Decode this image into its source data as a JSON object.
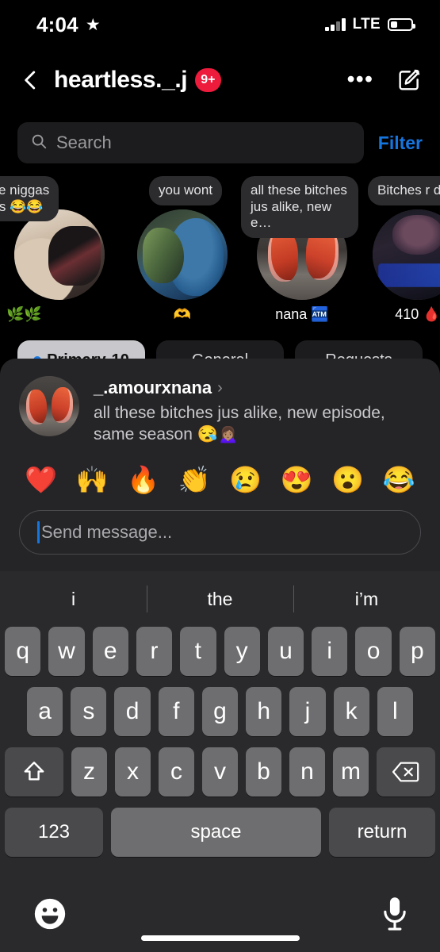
{
  "status_bar": {
    "time": "4:04",
    "star_icon": "star-icon",
    "signal_icon": "cellular-signal-icon",
    "network": "LTE",
    "battery_icon": "battery-icon",
    "battery_level": "35"
  },
  "header": {
    "back_icon": "back-chevron-icon",
    "title": "heartless._.j",
    "badge": "9+",
    "more_icon": "more-options-icon",
    "compose_icon": "compose-new-message-icon"
  },
  "search": {
    "icon": "search-icon",
    "placeholder": "Search",
    "filter_label": "Filter"
  },
  "notes": [
    {
      "bubble": "ese niggas\nhes 😂😂",
      "username": "🌿🌿",
      "avatar": "note-avatar-photo"
    },
    {
      "bubble": "you wont",
      "username": "🫶",
      "avatar": "note-avatar-photo"
    },
    {
      "bubble": "all these bitches\njus alike, new e…",
      "username": "nana 🏧",
      "avatar": "note-avatar-photo"
    },
    {
      "bubble": "Bitches r dicks",
      "username": "410 🩸",
      "avatar": "note-avatar-photo"
    }
  ],
  "inbox_tabs": [
    {
      "label": "Primary",
      "count": "10",
      "active": true
    },
    {
      "label": "General",
      "count": "",
      "active": false
    },
    {
      "label": "Requests",
      "count": "",
      "active": false
    }
  ],
  "reply_sheet": {
    "avatar": "sheet-avatar-photo",
    "username": "_.amourxnana",
    "chevron_icon": "chevron-right-icon",
    "note_text": "all these bitches jus alike, new episode, same season 😪🙍🏽‍♀️",
    "reactions": [
      "❤️",
      "🙌",
      "🔥",
      "👏",
      "😢",
      "😍",
      "😮",
      "😂"
    ],
    "composer_placeholder": "Send message..."
  },
  "keyboard": {
    "predictions": [
      "i",
      "the",
      "i’m"
    ],
    "row1": [
      "q",
      "w",
      "e",
      "r",
      "t",
      "y",
      "u",
      "i",
      "o",
      "p"
    ],
    "row2": [
      "a",
      "s",
      "d",
      "f",
      "g",
      "h",
      "j",
      "k",
      "l"
    ],
    "row3": [
      "z",
      "x",
      "c",
      "v",
      "b",
      "n",
      "m"
    ],
    "shift_icon": "shift-arrow-icon",
    "delete_icon": "backspace-delete-icon",
    "numbers_label": "123",
    "space_label": "space",
    "return_label": "return",
    "emoji_icon": "emoji-keyboard-icon",
    "dictation_icon": "microphone-dictation-icon"
  },
  "colors": {
    "badge_red": "#ED1B3C",
    "link_blue": "#1676E0",
    "sheet_bg": "#252527",
    "keyboard_bg": "#2A2A2C",
    "key_light": "#6E6E70",
    "key_dark": "#4A4A4C"
  }
}
